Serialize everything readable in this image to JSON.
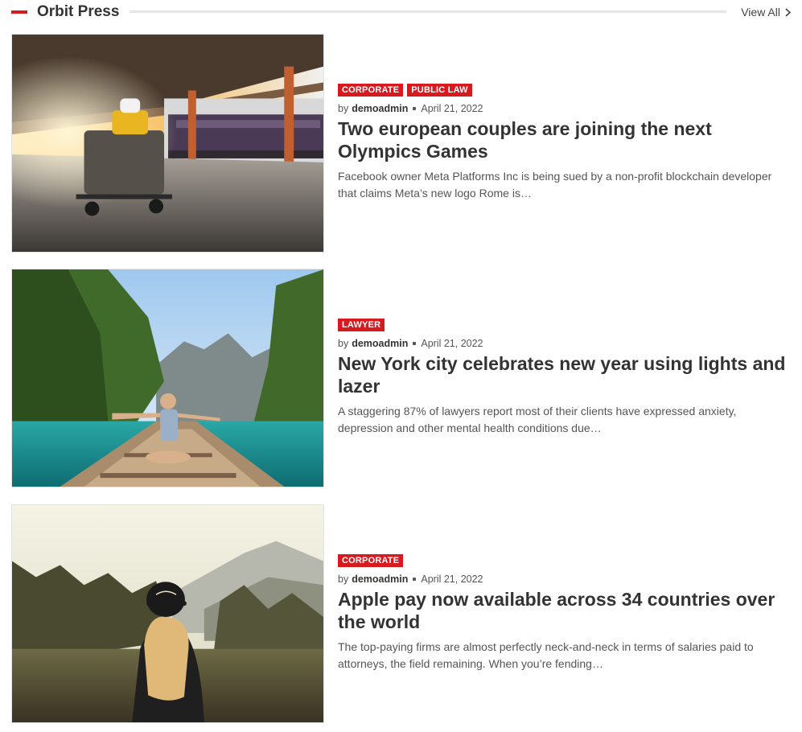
{
  "section": {
    "title": "Orbit Press",
    "view_all": "View All",
    "accent_color": "#d71920"
  },
  "posts": [
    {
      "categories": [
        "Corporate",
        "Public Law"
      ],
      "by": "by",
      "author": "demoadmin",
      "date": "April 21, 2022",
      "title": "Two european couples are joining the next Olympics Games",
      "excerpt": "Facebook owner Meta Platforms Inc is being sued by a non-profit blockchain developer that claims Meta’s new logo Rome is…",
      "image": "train-station-luggage"
    },
    {
      "categories": [
        "Lawyer"
      ],
      "by": "by",
      "author": "demoadmin",
      "date": "April 21, 2022",
      "title": "New York city celebrates new year using lights and lazer",
      "excerpt": "A staggering 87% of lawyers report most of their clients have expressed anxiety, depression and other mental health conditions due…",
      "image": "woman-on-boat"
    },
    {
      "categories": [
        "Corporate"
      ],
      "by": "by",
      "author": "demoadmin",
      "date": "April 21, 2022",
      "title": "Apple pay now available across 34 countries over the world",
      "excerpt": "The top-paying firms are almost perfectly neck-and-neck in terms of salaries paid to attorneys, the field remaining. When you’re fending…",
      "image": "woman-in-forest"
    }
  ]
}
